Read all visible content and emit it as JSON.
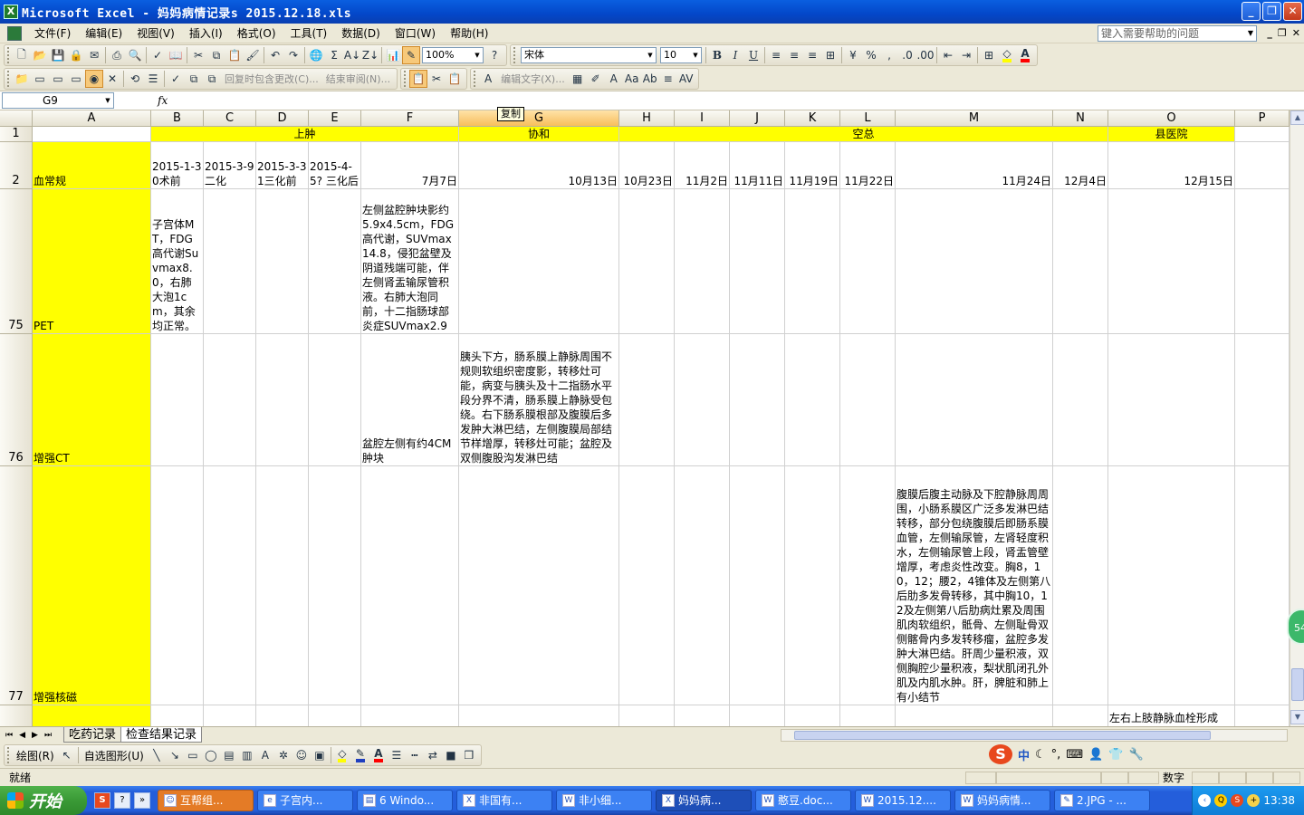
{
  "window": {
    "title": "Microsoft Excel - 妈妈病情记录s 2015.12.18.xls",
    "app_icon": "X"
  },
  "menu": {
    "items": [
      "文件(F)",
      "编辑(E)",
      "视图(V)",
      "插入(I)",
      "格式(O)",
      "工具(T)",
      "数据(D)",
      "窗口(W)",
      "帮助(H)"
    ],
    "help_placeholder": "键入需要帮助的问题"
  },
  "toolbar": {
    "zoom": "100%",
    "font": "宋体",
    "font_size": "10",
    "review_text": "回复时包含更改(C)...",
    "end_review": "结束审阅(N)...",
    "edit_text": "编辑文字(X)...",
    "fill_color": "#ffff00",
    "font_color": "#ff0000"
  },
  "formula": {
    "namebox": "G9",
    "fx": "fx",
    "content": ""
  },
  "tooltip": "复制",
  "columns": [
    "A",
    "B",
    "C",
    "D",
    "E",
    "F",
    "G",
    "H",
    "I",
    "J",
    "K",
    "L",
    "M",
    "N",
    "O",
    "P"
  ],
  "rows": [
    "1",
    "2",
    "75",
    "76",
    "77"
  ],
  "cells": {
    "r1_shangzhong": "上肿",
    "r1_xiehe": "协和",
    "r1_kongzong": "空总",
    "r1_xianyiyuan": "县医院",
    "r2_a": "血常规",
    "r2_b": "2015-1-30术前",
    "r2_c": "2015-3-9二化",
    "r2_d": "2015-3-31三化前",
    "r2_e": "2015-4-5? 三化后",
    "r2_f": "7月7日",
    "r2_g": "10月13日",
    "r2_h": "10月23日",
    "r2_i": "11月2日",
    "r2_j": "11月11日",
    "r2_k": "11月19日",
    "r2_l": "11月22日",
    "r2_m": "11月24日",
    "r2_n": "12月4日",
    "r2_o": "12月15日",
    "r75_a": "PET",
    "r75_b": "子宫体MT，FDG高代谢Suvmax8.0，右肺大泡1cm，其余均正常。",
    "r75_f": "左侧盆腔肿块影约5.9x4.5cm，FDG高代谢，SUVmax14.8，侵犯盆壁及阴道残端可能，伴左侧肾盂输尿管积液。右肺大泡同前，十二指肠球部炎症SUVmax2.9",
    "r76_a": "增强CT",
    "r76_f": "盆腔左侧有约4CM肿块",
    "r76_g": "胰头下方，肠系膜上静脉周围不规则软组织密度影，转移灶可能，病变与胰头及十二指肠水平段分界不清，肠系膜上静脉受包绕。右下肠系膜根部及腹膜后多发肿大淋巴结，左侧腹膜局部结节样增厚，转移灶可能；盆腔及双侧腹股沟发淋巴结",
    "r77_a": "增强核磁",
    "r77_m": "腹膜后腹主动脉及下腔静脉周周围，小肠系膜区广泛多发淋巴结转移，部分包绕腹膜后即肠系膜血管，左侧输尿管，左肾轻度积水，左侧输尿管上段，肾盂管壁增厚，考虑炎性改变。胸8，10，12；腰2，4锥体及左侧第八后肋多发骨转移，其中胸10，12及左侧第八后肋病灶累及周围肌肉软组织，骶骨、左侧耻骨双侧髂骨内多发转移瘤，盆腔多发肿大淋巴结。肝周少量积液，双侧胸腔少量积液，梨状肌闭孔外肌及内肌水肿。肝，脾脏和肺上有小结节",
    "r78_o": "左右上肢静脉血栓形成"
  },
  "sheets": [
    "吃药记录",
    "检查结果记录"
  ],
  "drawbar": {
    "draw": "绘图(R)",
    "autoshape": "自选图形(U)"
  },
  "ime": {
    "lang": "中"
  },
  "side_badge": "54",
  "status": {
    "ready": "就绪",
    "num": "数字"
  },
  "taskbar": {
    "start": "开始",
    "tasks": [
      "互帮组...",
      "子宫内...",
      "6 Windo...",
      "非国有...",
      "非小细...",
      "妈妈病...",
      "憨豆.doc...",
      "2015.12....",
      "妈妈病情...",
      "2.JPG - ..."
    ],
    "clock": "13:38"
  }
}
